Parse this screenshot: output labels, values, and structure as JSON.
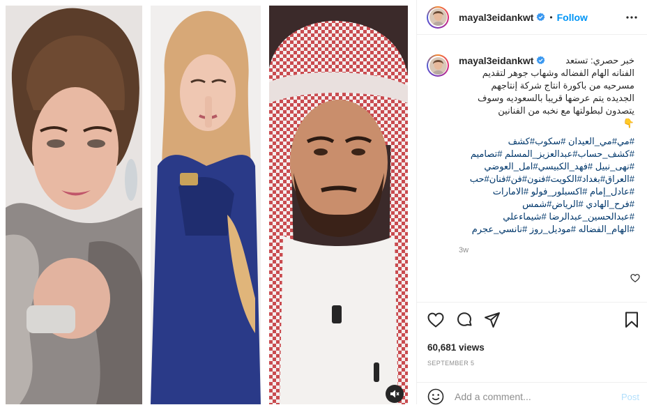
{
  "post": {
    "username": "mayal3eidankwt",
    "follow_label": "Follow",
    "separator": "•",
    "caption": {
      "lines": [
        "خبر حصري: تستعد",
        "الفنانه الهام الفضاله وشهاب جوهر لتقديم",
        "مسرحيه من باكورة انتاج شركة إنتاجهم",
        "الجديده يتم عرضها قريبا بالسعوديه وسوف",
        "يتصدون لبطولتها مع نخبه من الفنانين"
      ],
      "emoji": "👇",
      "hashtags": [
        "#مي#مي_العيدان #سكوب#كشف",
        "#كشف_حساب#عبدالعزيز_المسلم #تصاميم",
        "#نهى_نبيل #فهد_الكبيسي#امل_العوضي",
        "#العراق#بغداد#الكويت#فنون#فن#فنان#حب",
        "#عادل_إمام #اكسبلور_فولو #الامارات",
        "#فرح_الهادي #الرياض#شمس",
        "#عبدالحسين_عبدالرضا #شيماءعلي",
        "#الهام_الفضاله #موديل_روز #نانسي_عجرم"
      ],
      "time_ago": "3w"
    },
    "views": "60,681 views",
    "date": "SEPTEMBER 5",
    "comment": {
      "placeholder": "Add a comment...",
      "post_label": "Post"
    }
  },
  "icons": {
    "verified": "verified-badge-icon",
    "more": "more-options-icon",
    "like": "heart-icon",
    "comment": "comment-icon",
    "share": "paper-plane-icon",
    "save": "bookmark-icon",
    "emoji": "smiley-icon",
    "mute": "speaker-muted-icon"
  },
  "colors": {
    "accent": "#0095f6",
    "link": "#00376b",
    "muted": "#8e8e8e",
    "verified": "#3897f0",
    "post_disabled": "#b2dffc"
  }
}
